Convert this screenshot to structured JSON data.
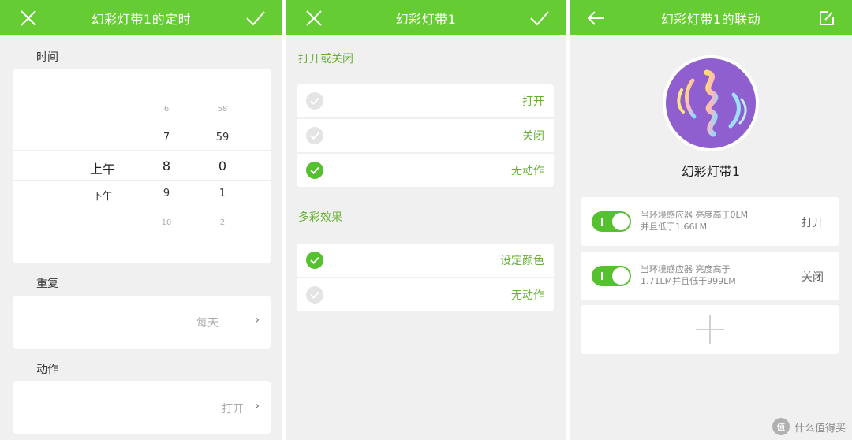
{
  "timer": {
    "title": "幻彩灯带1的定时",
    "close_icon": "close-icon",
    "confirm_icon": "check-icon",
    "time_label": "时间",
    "picker": {
      "ampm": {
        "selected": "上午",
        "next": "下午"
      },
      "hour": {
        "prev2": "6",
        "prev1": "7",
        "selected": "8",
        "next1": "9",
        "next2": "10"
      },
      "minute": {
        "prev2": "58",
        "prev1": "59",
        "selected": "0",
        "next1": "1",
        "next2": "2"
      }
    },
    "repeat_label": "重复",
    "repeat_value": "每天",
    "action_label": "动作",
    "action_value": "打开"
  },
  "action": {
    "title": "幻彩灯带1",
    "section1_label": "打开或关闭",
    "section1_options": [
      {
        "label": "打开",
        "checked": false
      },
      {
        "label": "关闭",
        "checked": false
      },
      {
        "label": "无动作",
        "checked": true
      }
    ],
    "section2_label": "多彩效果",
    "section2_options": [
      {
        "label": "设定颜色",
        "checked": true
      },
      {
        "label": "无动作",
        "checked": false
      }
    ]
  },
  "linkage": {
    "title": "幻彩灯带1的联动",
    "back_icon": "back-arrow-icon",
    "edit_icon": "edit-icon",
    "device_name": "幻彩灯带1",
    "rules": [
      {
        "line1": "当环境感应器 亮度高于0LM",
        "line2": "并且低于1.66LM",
        "action": "打开",
        "enabled": true
      },
      {
        "line1": "当环境感应器 亮度高于",
        "line2": "1.71LM并且低于999LM",
        "action": "关闭",
        "enabled": true
      }
    ],
    "add_icon": "plus-icon"
  },
  "watermark": {
    "logo": "值",
    "text": "什么值得买"
  },
  "colors": {
    "header": "#66cc33",
    "accent_green": "#55c12e",
    "label_green": "#66b033",
    "avatar_purple": "#8f5fd0"
  }
}
